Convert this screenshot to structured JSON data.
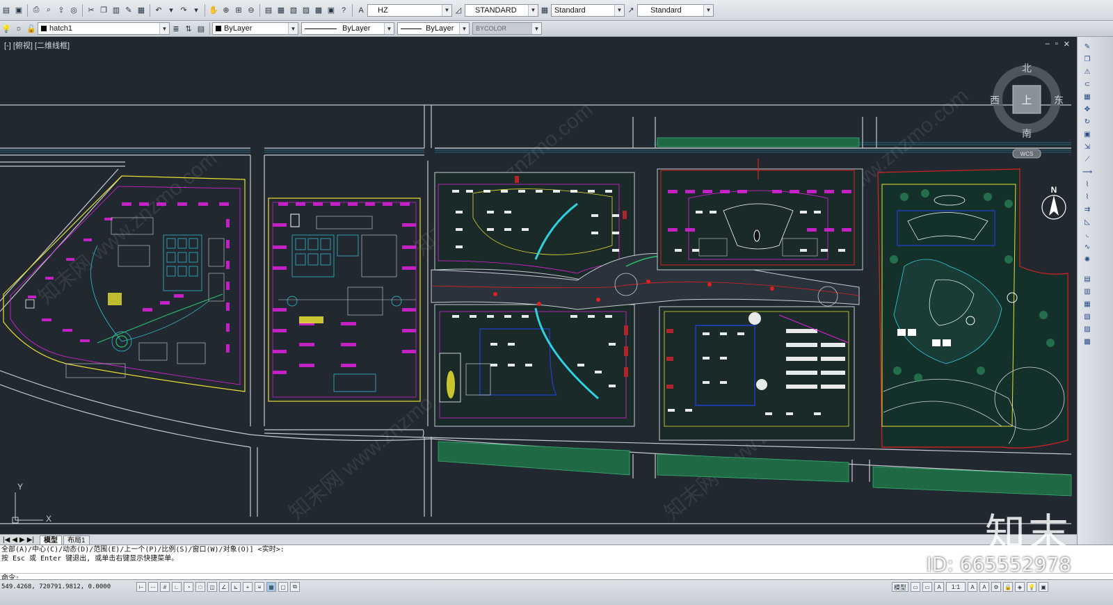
{
  "toolbar1": {
    "text_style": "HZ",
    "dim_style": "STANDARD",
    "table_style": "Standard",
    "mleader_style": "Standard"
  },
  "toolbar2": {
    "layer": "hatch1",
    "color": "ByLayer",
    "linetype": "ByLayer",
    "lineweight": "ByLayer",
    "plotstyle": "BYCOLOR"
  },
  "viewport": {
    "label": "[-] [俯视] [二维线框]",
    "controls": [
      "–",
      "▫",
      "✕"
    ]
  },
  "viewcube": {
    "north": "北",
    "south": "南",
    "east": "东",
    "west": "西",
    "face": "上",
    "wcs": "WCS"
  },
  "north_arrow": "N",
  "ucs": {
    "x": "X",
    "y": "Y"
  },
  "layout_tabs": [
    "模型",
    "布局1"
  ],
  "command": {
    "history": [
      "全部(A)/中心(C)/动态(D)/范围(E)/上一个(P)/比例(S)/窗口(W)/对象(O)] <实时>:",
      "按 Esc 或 Enter 键退出, 或单击右键显示快捷菜单。"
    ],
    "prompt": "命令:"
  },
  "status": {
    "coords": "549.4268, 720791.9812, 0.0000",
    "model": "模型",
    "scale": "1:1"
  },
  "watermark": {
    "logo": "知末",
    "id": "ID: 665552978",
    "diag": "知末网 www.znzmo.com"
  },
  "colors": {
    "canvas": "#212830",
    "road": "#d0d4d8",
    "green": "#1f7a4a",
    "magenta": "#e020e0",
    "yellow": "#e8e030",
    "cyan": "#30d0e0",
    "red": "#e02020"
  }
}
